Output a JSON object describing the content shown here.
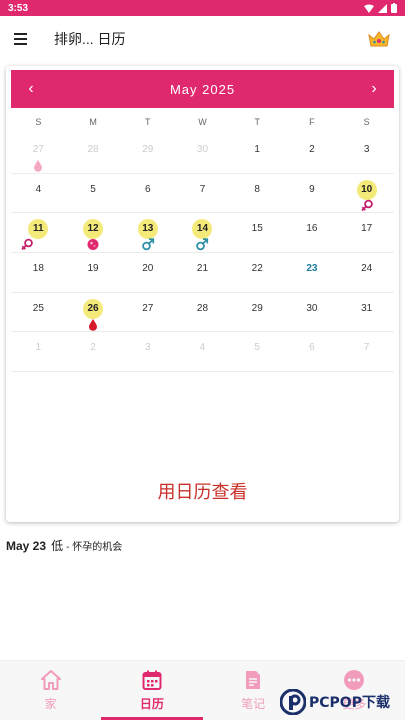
{
  "status": {
    "time": "3:53"
  },
  "app": {
    "title": "排卵... 日历",
    "icons": {
      "menu": "menu-icon",
      "premium": "crown-icon"
    }
  },
  "calendar": {
    "month_label": "May  2025",
    "prev_label": "‹",
    "next_label": "›",
    "weekdays": [
      "S",
      "M",
      "T",
      "W",
      "T",
      "F",
      "S"
    ],
    "weeks": [
      [
        {
          "d": "27",
          "faded": true,
          "mark": "drop-light"
        },
        {
          "d": "28",
          "faded": true
        },
        {
          "d": "29",
          "faded": true
        },
        {
          "d": "30",
          "faded": true
        },
        {
          "d": "1"
        },
        {
          "d": "2"
        },
        {
          "d": "3"
        }
      ],
      [
        {
          "d": "4"
        },
        {
          "d": "5"
        },
        {
          "d": "6"
        },
        {
          "d": "7"
        },
        {
          "d": "8"
        },
        {
          "d": "9"
        },
        {
          "d": "10",
          "hl": true,
          "mark": "ovulation"
        }
      ],
      [
        {
          "d": "11",
          "hl": true,
          "mark": "ovulation"
        },
        {
          "d": "12",
          "hl": true,
          "mark": "egg"
        },
        {
          "d": "13",
          "hl": true,
          "mark": "male"
        },
        {
          "d": "14",
          "hl": true,
          "mark": "male"
        },
        {
          "d": "15"
        },
        {
          "d": "16"
        },
        {
          "d": "17"
        }
      ],
      [
        {
          "d": "18"
        },
        {
          "d": "19"
        },
        {
          "d": "20"
        },
        {
          "d": "21"
        },
        {
          "d": "22"
        },
        {
          "d": "23",
          "today": true
        },
        {
          "d": "24"
        }
      ],
      [
        {
          "d": "25"
        },
        {
          "d": "26",
          "hl": true,
          "mark": "drop"
        },
        {
          "d": "27"
        },
        {
          "d": "28"
        },
        {
          "d": "29"
        },
        {
          "d": "30"
        },
        {
          "d": "31"
        }
      ],
      [
        {
          "d": "1",
          "faded": true
        },
        {
          "d": "2",
          "faded": true
        },
        {
          "d": "3",
          "faded": true
        },
        {
          "d": "4",
          "faded": true
        },
        {
          "d": "5",
          "faded": true
        },
        {
          "d": "6",
          "faded": true
        },
        {
          "d": "7",
          "faded": true
        }
      ]
    ],
    "footer_label": "用日历查看"
  },
  "info": {
    "date": "May 23",
    "level": "低",
    "desc": " - 怀孕的机会"
  },
  "nav": [
    {
      "label": "家",
      "icon": "home-icon",
      "active": false
    },
    {
      "label": "日历",
      "icon": "calendar-icon",
      "active": true
    },
    {
      "label": "笔记",
      "icon": "notes-icon",
      "active": false
    },
    {
      "label": "更多",
      "icon": "more-icon",
      "active": false
    }
  ],
  "watermark": {
    "text": "PCPOP下载"
  },
  "colors": {
    "accent": "#e0286e",
    "highlight": "#f4ea7a",
    "today": "#1a7a9a",
    "footer_text": "#c8302a",
    "male": "#2a8fa3"
  }
}
